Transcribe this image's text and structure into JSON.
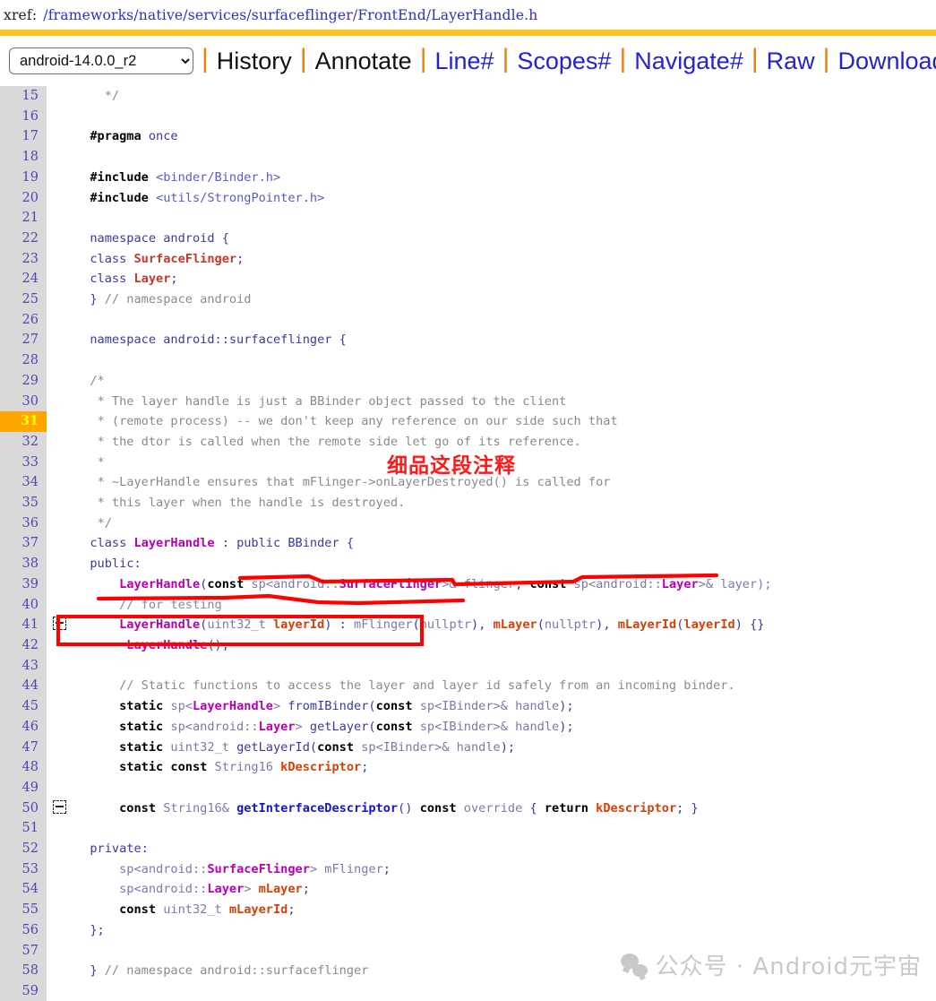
{
  "header": {
    "xref_label": "xref:",
    "path": "/frameworks/native/services/surfaceflinger/FrontEnd/LayerHandle.h",
    "accent_color": "#ffc220"
  },
  "navbar": {
    "branch_selected": "android-14.0.0_r2",
    "branch_options": [
      "android-14.0.0_r2"
    ],
    "separator": "|",
    "separator_color": "#e8820c",
    "link_color": "#2424c8",
    "links": [
      {
        "label": "History",
        "style": "plain"
      },
      {
        "label": "Annotate",
        "style": "plain"
      },
      {
        "label": "Line#",
        "style": "link"
      },
      {
        "label": "Scopes#",
        "style": "link"
      },
      {
        "label": "Navigate#",
        "style": "link"
      },
      {
        "label": "Raw",
        "style": "link"
      },
      {
        "label": "Download",
        "style": "link"
      }
    ]
  },
  "annotations": {
    "chinese_note": "细品这段注释",
    "note_color": "#ff1a1a",
    "box_color": "#ff0000",
    "boxed_line": 37,
    "underlined_lines": [
      34,
      35
    ]
  },
  "watermark": {
    "text": "公众号 · Android元宇宙",
    "icon": "wechat-icon",
    "color": "#c9c9c9"
  },
  "editor": {
    "highlighted_line": 31,
    "highlight_bg": "#ffa500",
    "highlight_fg": "#ffff00",
    "gutter_bg": "#d9d9d9",
    "first_visible_line": 15,
    "last_visible_line": 59,
    "fold_markers": [
      41,
      50
    ],
    "lines": [
      {
        "n": 15,
        "html": "    <span class='cmt'>*/</span>"
      },
      {
        "n": 16,
        "html": ""
      },
      {
        "n": 17,
        "html": "  <span class='pp'>#pragma</span> <span class='pln'>once</span>"
      },
      {
        "n": 18,
        "html": ""
      },
      {
        "n": 19,
        "html": "  <span class='pp'>#include</span> <span class='str'>&lt;binder/Binder.h&gt;</span>"
      },
      {
        "n": 20,
        "html": "  <span class='pp'>#include</span> <span class='str'>&lt;utils/StrongPointer.h&gt;</span>"
      },
      {
        "n": 21,
        "html": ""
      },
      {
        "n": 22,
        "html": "  <span class='pln'>namespace android {</span>"
      },
      {
        "n": 23,
        "html": "  <span class='pln'>class </span><span class='typ'>SurfaceFlinger</span><span class='pln'>;</span>"
      },
      {
        "n": 24,
        "html": "  <span class='pln'>class </span><span class='typ'>Layer</span><span class='pln'>;</span>"
      },
      {
        "n": 25,
        "html": "  <span class='pln'>} </span><span class='cmt'>// namespace android</span>"
      },
      {
        "n": 26,
        "html": ""
      },
      {
        "n": 27,
        "html": "  <span class='pln'>namespace android::surfaceflinger {</span>"
      },
      {
        "n": 28,
        "html": ""
      },
      {
        "n": 29,
        "html": "  <span class='cmt'>/*</span>"
      },
      {
        "n": 30,
        "html": "   <span class='cmt'>* The layer handle is just a BBinder object passed to the client</span>"
      },
      {
        "n": 31,
        "html": "   <span class='cmt'>* (remote process) -- we don't keep any reference on our side such that</span>"
      },
      {
        "n": 32,
        "html": "   <span class='cmt'>* the dtor is called when the remote side let go of its reference.</span>"
      },
      {
        "n": 33,
        "html": "   <span class='cmt'>*</span>"
      },
      {
        "n": 34,
        "html": "   <span class='cmt'>* ~LayerHandle ensures that mFlinger-&gt;onLayerDestroyed() is called for</span>"
      },
      {
        "n": 35,
        "html": "   <span class='cmt'>* this layer when the handle is destroyed.</span>"
      },
      {
        "n": 36,
        "html": "   <span class='cmt'>*/</span>"
      },
      {
        "n": 37,
        "html": "  <span class='pln'>class </span><span class='cls'>LayerHandle</span><span class='pln'> : public BBinder {</span>"
      },
      {
        "n": 38,
        "html": "  <span class='pln'>public</span><span class='pln'>:</span>"
      },
      {
        "n": 39,
        "html": "      <span class='cls'>LayerHandle</span><span class='pln'>(</span><span class='kw'>const</span><span class='dim'> sp&lt;android::</span><span class='cls'>SurfaceFlinger</span><span class='dim'>&gt;&amp; flinger</span><span class='pln'>, </span><span class='kw'>const</span><span class='dim'> sp&lt;android::</span><span class='cls'>Layer</span><span class='dim'>&gt;&amp; layer);</span>"
      },
      {
        "n": 40,
        "html": "      <span class='cmt'>// for testing</span>"
      },
      {
        "n": 41,
        "html": "      <span class='cls'>LayerHandle</span><span class='pln'>(</span><span class='dim'>uint32_t </span><span class='mem'>layerId</span><span class='pln'>) : </span><span class='dim'>mFlinger</span><span class='pln'>(</span><span class='dim'>nullptr</span><span class='pln'>), </span><span class='mem'>mLayer</span><span class='pln'>(</span><span class='dim'>nullptr</span><span class='pln'>), </span><span class='mem'>mLayerId</span><span class='pln'>(</span><span class='mem'>layerId</span><span class='pln'>) {}</span>"
      },
      {
        "n": 42,
        "html": "      <span class='cls'>~LayerHandle</span><span class='pln'>();</span>"
      },
      {
        "n": 43,
        "html": ""
      },
      {
        "n": 44,
        "html": "      <span class='cmt'>// Static functions to access the layer and layer id safely from an incoming binder.</span>"
      },
      {
        "n": 45,
        "html": "      <span class='kw'>static</span><span class='dim'> sp&lt;</span><span class='cls'>LayerHandle</span><span class='dim'>&gt; </span><span class='pln'>fromIBinder</span><span class='pln'>(</span><span class='kw'>const</span><span class='dim'> sp&lt;IBinder&gt;&amp; handle</span><span class='pln'>);</span>"
      },
      {
        "n": 46,
        "html": "      <span class='kw'>static</span><span class='dim'> sp&lt;android::</span><span class='cls'>Layer</span><span class='dim'>&gt; </span><span class='pln'>getLayer</span><span class='pln'>(</span><span class='kw'>const</span><span class='dim'> sp&lt;IBinder&gt;&amp; handle</span><span class='pln'>);</span>"
      },
      {
        "n": 47,
        "html": "      <span class='kw'>static</span><span class='dim'> uint32_t </span><span class='pln'>getLayerId</span><span class='pln'>(</span><span class='kw'>const</span><span class='dim'> sp&lt;IBinder&gt;&amp; handle</span><span class='pln'>);</span>"
      },
      {
        "n": 48,
        "html": "      <span class='kw'>static const</span><span class='dim'> String16 </span><span class='mem'>kDescriptor</span><span class='pln'>;</span>"
      },
      {
        "n": 49,
        "html": ""
      },
      {
        "n": 50,
        "html": "      <span class='kw'>const</span><span class='dim'> String16&amp; </span><span class='fn'>getInterfaceDescriptor</span><span class='pln'>() </span><span class='kw'>const</span><span class='dim'> override</span><span class='pln'> { </span><span class='kw'>return</span><span class='pln'> </span><span class='mem'>kDescriptor</span><span class='pln'>; }</span>"
      },
      {
        "n": 51,
        "html": ""
      },
      {
        "n": 52,
        "html": "  <span class='pln'>private:</span>"
      },
      {
        "n": 53,
        "html": "      <span class='dim'>sp&lt;android::</span><span class='cls'>SurfaceFlinger</span><span class='dim'>&gt; mFlinger</span><span class='pln'>;</span>"
      },
      {
        "n": 54,
        "html": "      <span class='dim'>sp&lt;android::</span><span class='cls'>Layer</span><span class='dim'>&gt; </span><span class='mem'>mLayer</span><span class='pln'>;</span>"
      },
      {
        "n": 55,
        "html": "      <span class='kw'>const</span><span class='dim'> uint32_t </span><span class='mem'>mLayerId</span><span class='pln'>;</span>"
      },
      {
        "n": 56,
        "html": "  <span class='pln'>};</span>"
      },
      {
        "n": 57,
        "html": ""
      },
      {
        "n": 58,
        "html": "  <span class='pln'>} </span><span class='cmt'>// namespace android::surfaceflinger</span>"
      },
      {
        "n": 59,
        "html": ""
      }
    ]
  }
}
